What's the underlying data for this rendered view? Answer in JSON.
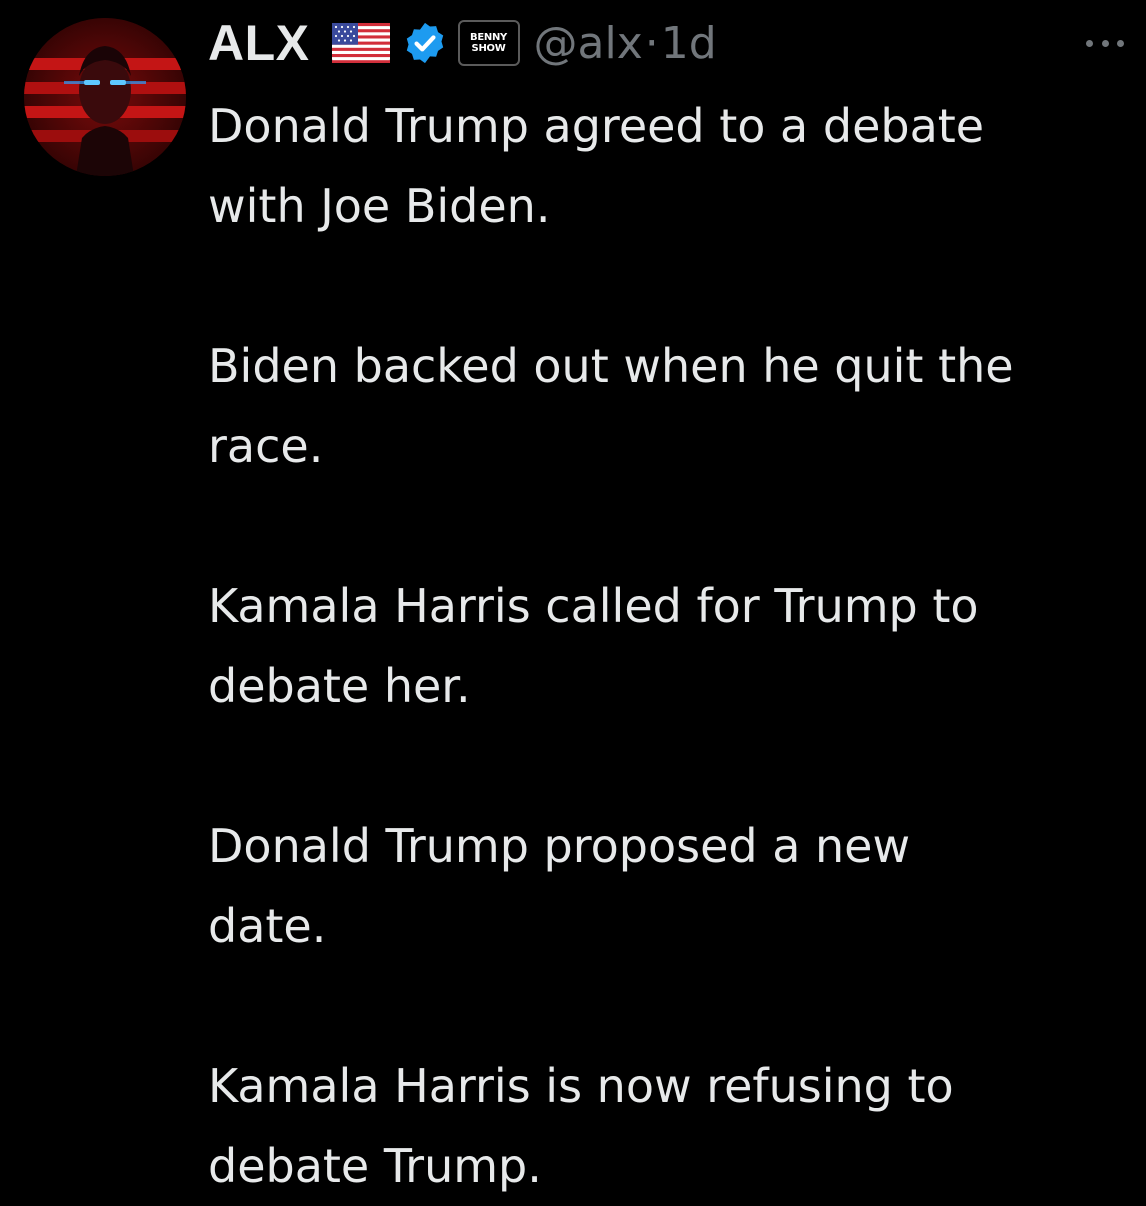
{
  "tweet": {
    "author": {
      "display_name": "ALX",
      "handle": "@alx",
      "badges": {
        "flag": "us-flag-icon",
        "verified": "verified-checkmark-icon",
        "affiliate_line1": "BENNY",
        "affiliate_line2": "SHOW"
      }
    },
    "separator": "·",
    "timestamp": "1d",
    "more_menu": "more-options-icon",
    "text": {
      "line_1": "Donald Trump agreed to a debate",
      "line_2": "with Joe Biden.",
      "line_3": "Biden backed out when he quit the",
      "line_4": "race.",
      "line_5": "Kamala Harris called for Trump to",
      "line_6": "debate her.",
      "line_7": "Donald Trump proposed a new",
      "line_8": "date.",
      "line_9": "Kamala Harris is now refusing to",
      "line_10": "debate Trump."
    }
  },
  "colors": {
    "background": "#000000",
    "text_primary": "#e7e9ea",
    "text_secondary": "#71767b",
    "verified_blue": "#1d9bf0"
  }
}
